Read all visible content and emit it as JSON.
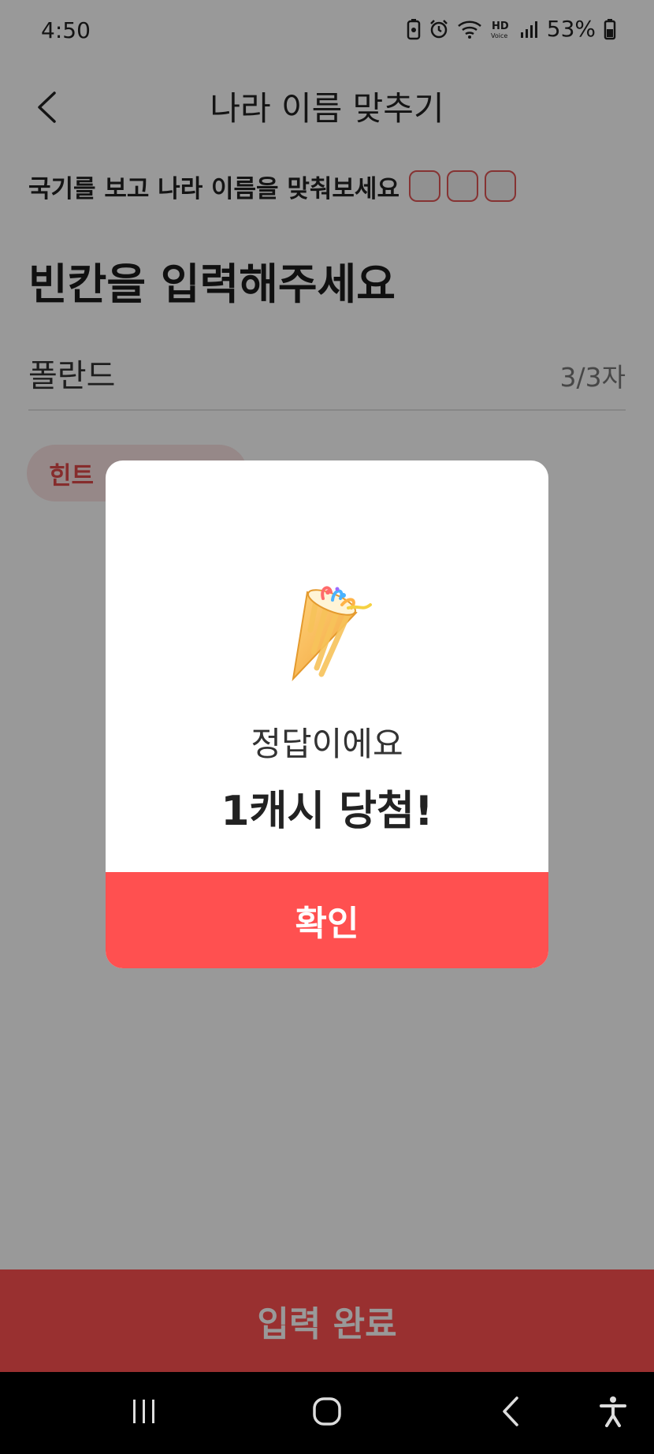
{
  "status_bar": {
    "time": "4:50",
    "battery_percent": "53%",
    "icons": [
      "battery-saver-icon",
      "alarm-icon",
      "wifi-icon",
      "hd-voice-icon",
      "signal-icon",
      "battery-icon"
    ]
  },
  "header": {
    "title": "나라 이름 맞추기",
    "back_icon": "chevron-left-icon"
  },
  "quiz": {
    "instruction": "국기를 보고 나라 이름을 맞춰보세요",
    "flag_boxes": 3,
    "prompt": "빈칸을 입력해주세요",
    "answer_value": "폴란드",
    "char_count": "3/3자",
    "hint_label": "힌트"
  },
  "footer": {
    "submit_label": "입력 완료"
  },
  "dialog": {
    "illustration": "party-popper-icon",
    "message": "정답이에요",
    "reward": "1캐시 당첨!",
    "confirm_label": "확인"
  },
  "nav_bar": {
    "icons": [
      "recent-apps-icon",
      "home-icon",
      "back-icon",
      "accessibility-icon"
    ]
  },
  "colors": {
    "accent": "#ff5050",
    "hint_chip_bg": "#fbe3e3",
    "overlay": "rgba(0,0,0,0.40)"
  }
}
